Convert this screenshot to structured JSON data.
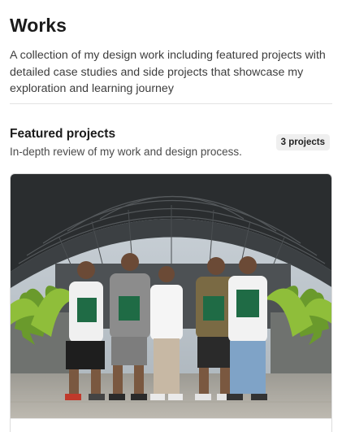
{
  "header": {
    "title": "Works",
    "description": "A collection of my design work including featured projects with detailed case studies and side projects that showcase my exploration and learning journey"
  },
  "featured": {
    "title": "Featured projects",
    "subtitle": "In-depth review of my work and design process.",
    "count_badge": "3 projects"
  },
  "colors": {
    "text_primary": "#1b1b1b",
    "text_secondary": "#3d3d3d",
    "badge_bg": "#efefef",
    "divider": "#e3e3e3"
  }
}
